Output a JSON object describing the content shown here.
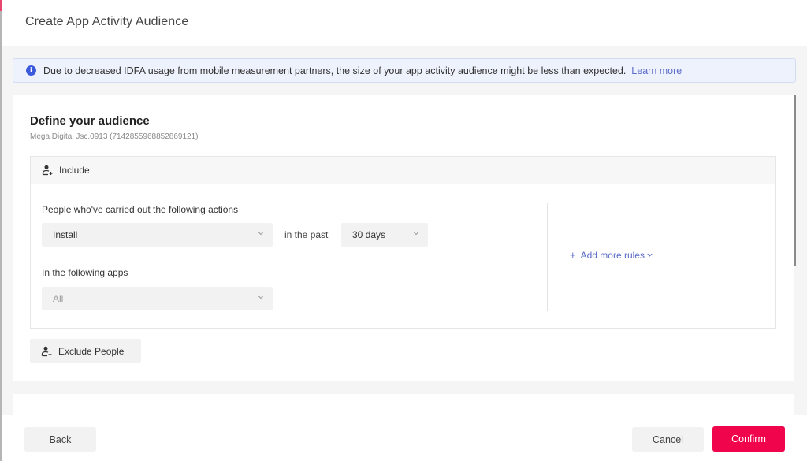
{
  "modal": {
    "title": "Create App Activity Audience"
  },
  "notice": {
    "icon": "info-icon",
    "text": "Due to decreased IDFA usage from mobile measurement partners, the size of your app activity audience might be less than expected.",
    "link_label": "Learn more"
  },
  "define": {
    "title": "Define your audience",
    "account": "Mega Digital Jsc.0913 (7142855968852869121)"
  },
  "include": {
    "label": "Include",
    "icon": "person-add-icon",
    "actions_label": "People who've carried out the following actions",
    "action_value": "Install",
    "in_the_past_label": "in the past",
    "period_value": "30 days",
    "apps_label": "In the following apps",
    "apps_value": "All",
    "add_rules_label": "Add more rules"
  },
  "exclude": {
    "label": "Exclude People",
    "icon": "person-remove-icon"
  },
  "footer": {
    "back_label": "Back",
    "cancel_label": "Cancel",
    "confirm_label": "Confirm"
  },
  "colors": {
    "primary": "#f0054d",
    "link": "#5b6bc9",
    "info": "#3b5bdb"
  }
}
